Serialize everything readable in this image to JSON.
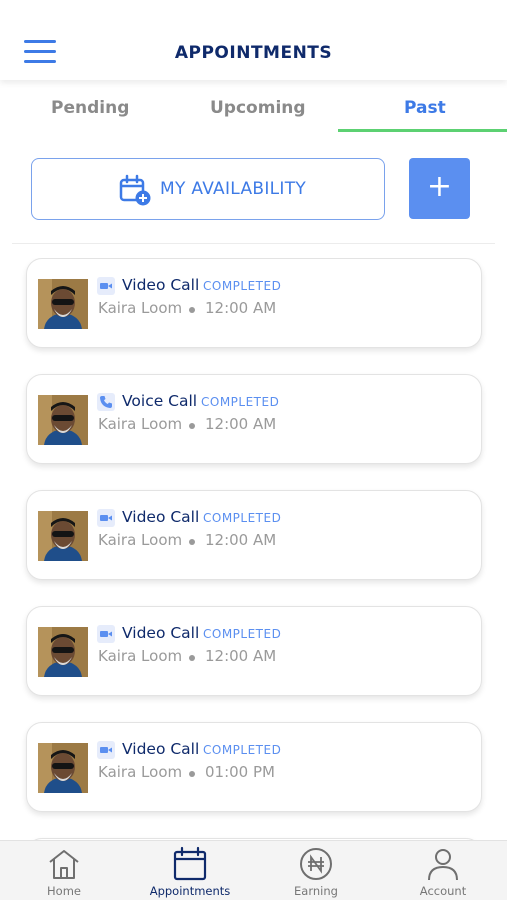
{
  "header": {
    "title": "APPOINTMENTS",
    "menu_icon": "hamburger-menu-icon"
  },
  "tabs": [
    {
      "label": "Pending",
      "active": false
    },
    {
      "label": "Upcoming",
      "active": false
    },
    {
      "label": "Past",
      "active": true
    }
  ],
  "actions": {
    "availability_label": "MY AVAILABILITY",
    "availability_icon": "calendar-add-icon",
    "add_label": "+"
  },
  "appointments": [
    {
      "type": "Video Call",
      "type_icon": "video-camera-icon",
      "status": "COMPLETED",
      "name": "Kaira Loom",
      "time": "12:00 AM"
    },
    {
      "type": "Voice Call",
      "type_icon": "phone-icon",
      "status": "COMPLETED",
      "name": "Kaira Loom",
      "time": "12:00 AM"
    },
    {
      "type": "Video Call",
      "type_icon": "video-camera-icon",
      "status": "COMPLETED",
      "name": "Kaira Loom",
      "time": "12:00 AM"
    },
    {
      "type": "Video Call",
      "type_icon": "video-camera-icon",
      "status": "COMPLETED",
      "name": "Kaira Loom",
      "time": "12:00 AM"
    },
    {
      "type": "Video Call",
      "type_icon": "video-camera-icon",
      "status": "COMPLETED",
      "name": "Kaira Loom",
      "time": "01:00 PM"
    }
  ],
  "bottom_nav": [
    {
      "label": "Home",
      "icon": "home-icon",
      "active": false
    },
    {
      "label": "Appointments",
      "icon": "calendar-icon",
      "active": true
    },
    {
      "label": "Earning",
      "icon": "naira-coin-icon",
      "active": false
    },
    {
      "label": "Account",
      "icon": "user-icon",
      "active": false
    }
  ],
  "colors": {
    "primary": "#3d7ae6",
    "navy": "#0f2a6b",
    "tab_indicator": "#5cd172",
    "status_text": "#5b8ff0",
    "muted_text": "#9a9a9a"
  }
}
